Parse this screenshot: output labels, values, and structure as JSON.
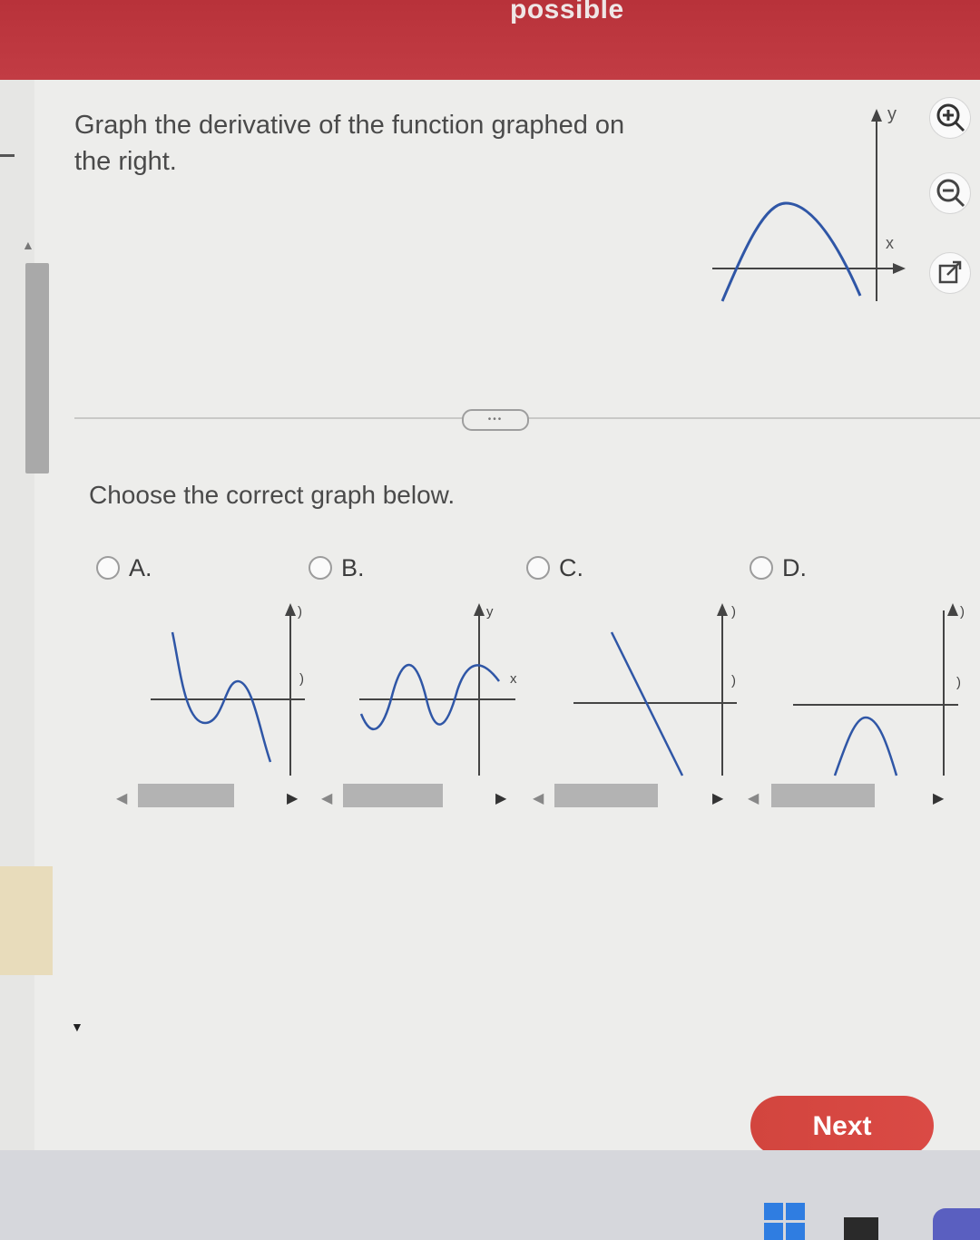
{
  "header": {
    "title": "possible",
    "color": "#c23c44"
  },
  "question": {
    "text": "Graph the derivative of the function graphed on the right."
  },
  "main_graph": {
    "y_label": "y",
    "x_label": "x",
    "curve_color": "#2f56a6"
  },
  "tools": {
    "zoom_in_icon": "zoom-in-icon",
    "zoom_out_icon": "zoom-out-icon",
    "popout_icon": "external-link-icon"
  },
  "divider": {
    "handle_text": "•••"
  },
  "prompt": "Choose the correct graph below.",
  "options": [
    {
      "label": "A.",
      "axis_y": ")",
      "axis_x": ")"
    },
    {
      "label": "B.",
      "axis_y": "y",
      "axis_x": "x"
    },
    {
      "label": "C.",
      "axis_y": ")",
      "axis_x": ")"
    },
    {
      "label": "D.",
      "axis_y": ")",
      "axis_x": ")"
    }
  ],
  "next_button": {
    "label": "Next",
    "color": "#d94842"
  }
}
